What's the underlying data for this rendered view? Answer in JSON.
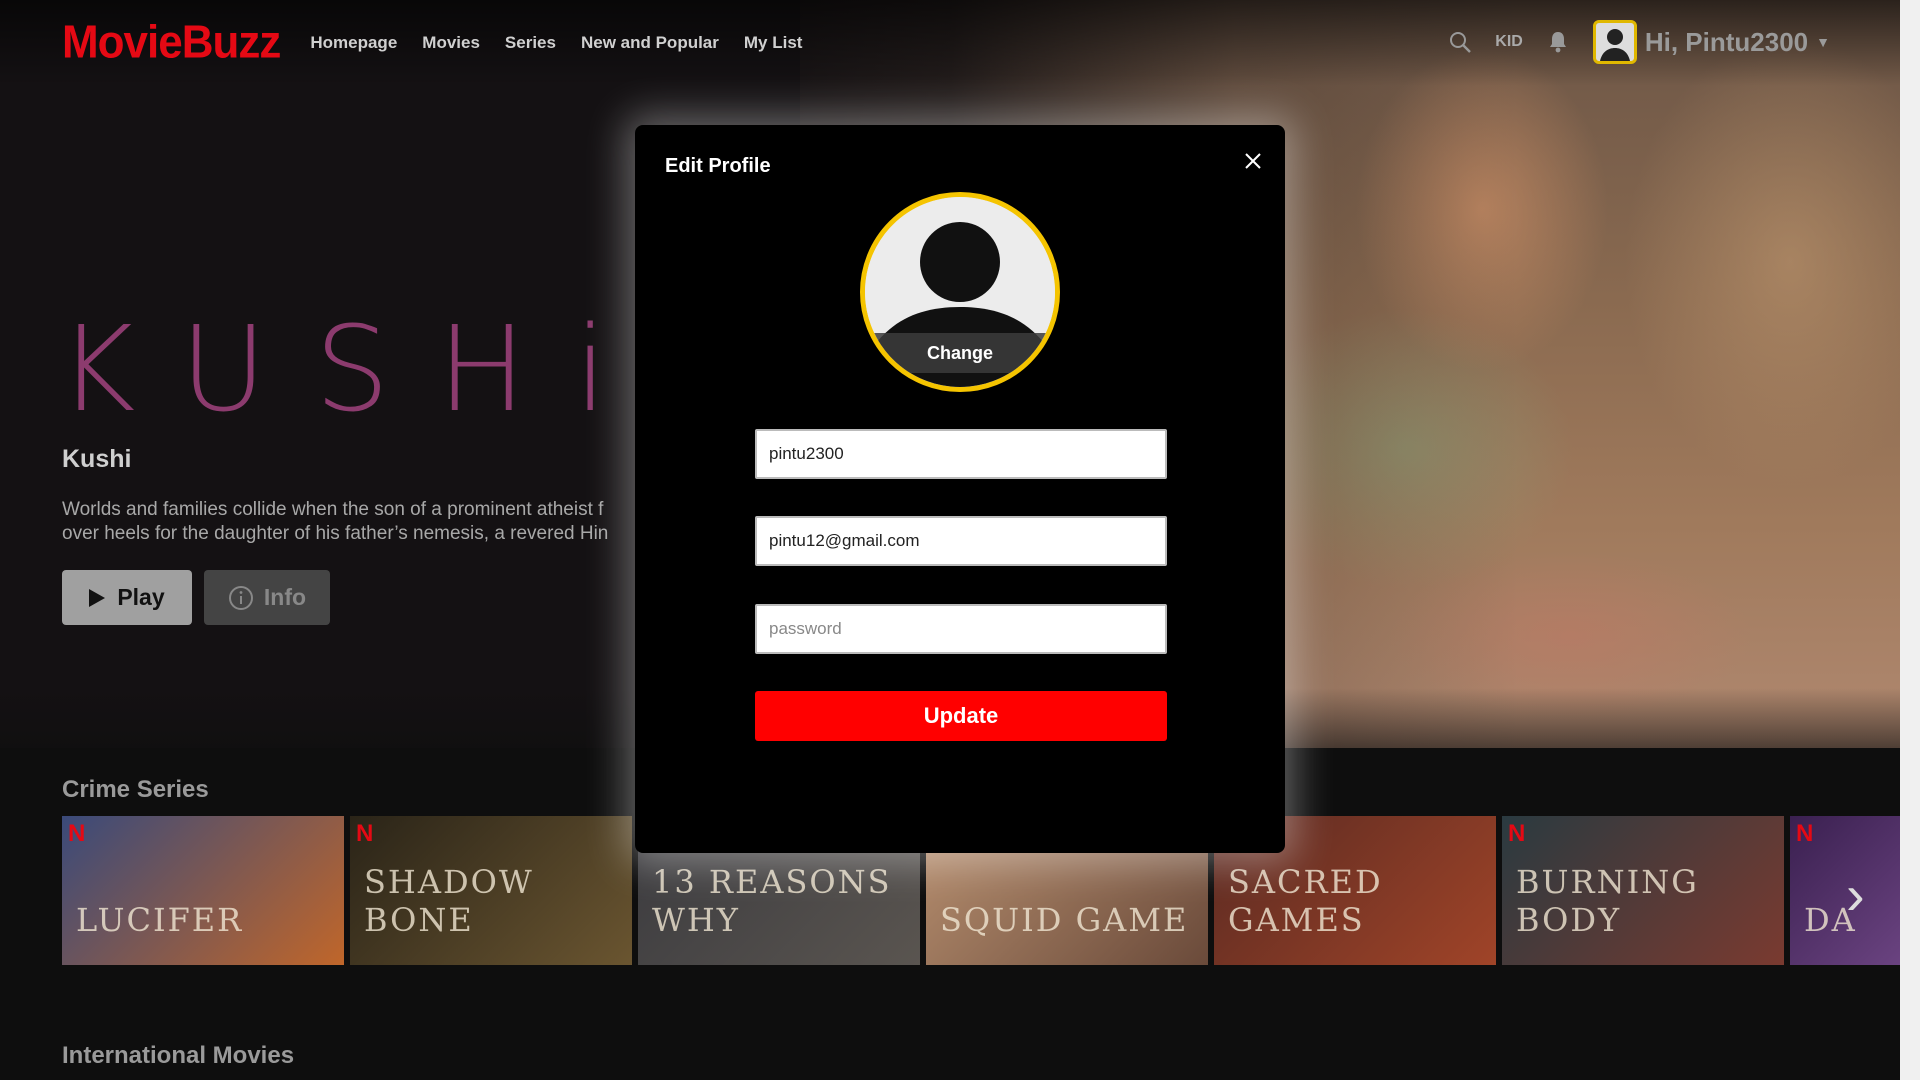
{
  "nav": {
    "logo": "MovieBuzz",
    "links": [
      "Homepage",
      "Movies",
      "Series",
      "New and Popular",
      "My List"
    ],
    "kid_label": "KID",
    "greeting": "Hi,  Pintu2300"
  },
  "hero": {
    "title_art": "KUSHi",
    "title": "Kushi",
    "description_line1": "Worlds and families collide when the son of a prominent atheist f",
    "description_line2": "over heels for the daughter of his father’s nemesis, a revered Hin",
    "play_label": "Play",
    "info_label": "Info"
  },
  "rows": {
    "crime_title": "Crime Series",
    "crime_cards": [
      {
        "title": "LUCIFER",
        "colors": [
          "#3a4a7a",
          "#c0662a"
        ]
      },
      {
        "title": "SHADOW BONE",
        "colors": [
          "#2a2418",
          "#6a5530"
        ]
      },
      {
        "title": "13 REASONS WHY",
        "colors": [
          "#3a3a3e",
          "#5a5550"
        ]
      },
      {
        "title": "SQUID GAME",
        "colors": [
          "#b89070",
          "#6a4a3a"
        ]
      },
      {
        "title": "SACRED GAMES",
        "colors": [
          "#5a2a22",
          "#a04428"
        ]
      },
      {
        "title": "BURNING BODY",
        "colors": [
          "#2a3a40",
          "#7a3a30"
        ]
      },
      {
        "title": "DA",
        "colors": [
          "#3a2050",
          "#8a5aa0"
        ]
      }
    ],
    "intl_title": "International Movies"
  },
  "modal": {
    "title": "Edit Profile",
    "change_label": "Change",
    "username_value": "pintu2300",
    "email_value": "pintu12@gmail.com",
    "password_placeholder": "password",
    "update_label": "Update"
  },
  "colors": {
    "brand": "#e50914",
    "avatar_ring": "#f5c400",
    "update_button": "#ff0000"
  }
}
